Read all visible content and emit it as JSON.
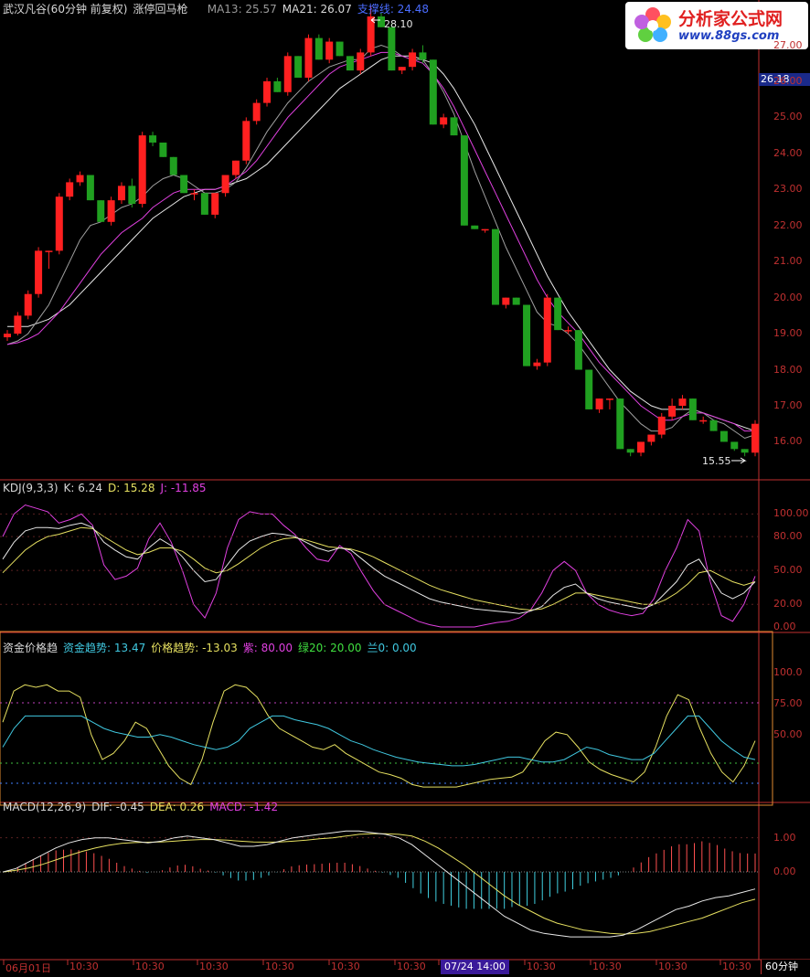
{
  "header": {
    "stock_title": "武汉凡谷(60分钟 前复权)",
    "indicator_name": "涨停回马枪",
    "ma13": "MA13: 25.57",
    "ma21": "MA21: 26.07",
    "support": "支撑线: 24.48"
  },
  "logo": {
    "title": "分析家公式网",
    "url": "www.88gs.com"
  },
  "price_panel": {
    "current_price": "26.18",
    "high_label": "28.10",
    "low_label": "15.55",
    "axis_labels": [
      "27.00",
      "26.00",
      "25.00",
      "24.00",
      "23.00",
      "22.00",
      "21.00",
      "20.00",
      "19.00",
      "18.00",
      "17.00",
      "16.00"
    ],
    "ylim": [
      15.2,
      27.9
    ]
  },
  "kdj_panel": {
    "title": "KDJ(9,3,3)",
    "k": "K: 6.24",
    "d": "D: 15.28",
    "j": "J: -11.85",
    "axis_labels": [
      "100.00",
      "80.00",
      "50.00",
      "20.00",
      "0.00"
    ]
  },
  "fund_panel": {
    "title": "资金价格趋",
    "fund": "资金趋势: 13.47",
    "price": "价格趋势: -13.03",
    "purple": "紫: 80.00",
    "green": "绿20: 20.00",
    "blue": "兰0: 0.00",
    "axis_labels": [
      "100.0",
      "75.00",
      "50.00"
    ]
  },
  "macd_panel": {
    "title": "MACD(12,26,9)",
    "dif": "DIF: -0.45",
    "dea": "DEA: 0.26",
    "macd": "MACD: -1.42",
    "axis_labels": [
      "1.00",
      "0.00"
    ]
  },
  "x_axis": {
    "labels": [
      "06月01日",
      "10:30",
      "10:30",
      "10:30",
      "10:30",
      "10:30",
      "10:30",
      "07/24 14:00",
      "10:30",
      "10:30",
      "10:30",
      "10:30"
    ],
    "period": "60分钟"
  },
  "colors": {
    "up": "#ff2020",
    "down": "#20a020",
    "grid": "#c03030",
    "ma5": "#ffffff",
    "ma13": "#e040e0",
    "ma21": "#ffffff"
  },
  "chart_data": {
    "type": "candlestick",
    "candles": [
      [
        18.9,
        19.1,
        18.8,
        19.0
      ],
      [
        19.0,
        19.6,
        18.95,
        19.5
      ],
      [
        19.5,
        20.2,
        19.4,
        20.1
      ],
      [
        20.1,
        21.4,
        20.0,
        21.3
      ],
      [
        21.3,
        21.3,
        20.8,
        21.3
      ],
      [
        21.3,
        22.9,
        21.2,
        22.8
      ],
      [
        22.8,
        23.3,
        22.7,
        23.2
      ],
      [
        23.2,
        23.5,
        23.1,
        23.4
      ],
      [
        23.4,
        23.4,
        22.7,
        22.7
      ],
      [
        22.7,
        22.7,
        22.1,
        22.1
      ],
      [
        22.1,
        22.8,
        22.0,
        22.7
      ],
      [
        22.7,
        23.2,
        22.6,
        23.1
      ],
      [
        23.1,
        23.3,
        22.5,
        22.6
      ],
      [
        22.6,
        24.6,
        22.5,
        24.5
      ],
      [
        24.5,
        24.6,
        24.2,
        24.3
      ],
      [
        24.3,
        24.3,
        23.9,
        23.9
      ],
      [
        23.9,
        23.9,
        23.4,
        23.4
      ],
      [
        23.4,
        23.4,
        22.9,
        22.9
      ],
      [
        22.9,
        23.0,
        22.7,
        22.9
      ],
      [
        22.9,
        22.9,
        22.3,
        22.3
      ],
      [
        22.3,
        22.9,
        22.2,
        22.9
      ],
      [
        22.9,
        23.4,
        22.8,
        23.4
      ],
      [
        23.4,
        23.8,
        23.3,
        23.8
      ],
      [
        23.8,
        25.0,
        23.7,
        24.9
      ],
      [
        24.9,
        25.5,
        24.8,
        25.4
      ],
      [
        25.4,
        26.1,
        25.3,
        26.0
      ],
      [
        26.0,
        26.1,
        25.7,
        25.7
      ],
      [
        25.7,
        26.8,
        25.6,
        26.7
      ],
      [
        26.7,
        26.7,
        26.1,
        26.1
      ],
      [
        26.1,
        27.3,
        26.0,
        27.2
      ],
      [
        27.2,
        27.3,
        26.6,
        26.6
      ],
      [
        26.6,
        27.2,
        26.5,
        27.1
      ],
      [
        27.1,
        27.1,
        26.7,
        26.7
      ],
      [
        26.7,
        26.7,
        26.3,
        26.3
      ],
      [
        26.3,
        26.9,
        26.2,
        26.8
      ],
      [
        26.8,
        28.1,
        26.7,
        27.8
      ],
      [
        27.8,
        27.9,
        27.5,
        27.5
      ],
      [
        27.5,
        27.6,
        26.3,
        26.3
      ],
      [
        26.3,
        26.4,
        26.2,
        26.4
      ],
      [
        26.4,
        26.9,
        26.3,
        26.8
      ],
      [
        26.8,
        27.0,
        26.5,
        26.6
      ],
      [
        26.6,
        26.6,
        24.8,
        24.8
      ],
      [
        24.8,
        25.1,
        24.7,
        25.0
      ],
      [
        25.0,
        25.0,
        24.5,
        24.5
      ],
      [
        24.5,
        24.5,
        22.0,
        22.0
      ],
      [
        22.0,
        22.0,
        21.9,
        21.9
      ],
      [
        21.9,
        21.9,
        21.8,
        21.9
      ],
      [
        21.9,
        21.9,
        19.8,
        19.8
      ],
      [
        19.8,
        20.0,
        19.7,
        20.0
      ],
      [
        20.0,
        20.0,
        19.8,
        19.8
      ],
      [
        19.8,
        19.8,
        18.1,
        18.1
      ],
      [
        18.1,
        18.3,
        18.0,
        18.2
      ],
      [
        18.2,
        20.1,
        18.1,
        20.0
      ],
      [
        20.0,
        20.0,
        19.1,
        19.1
      ],
      [
        19.1,
        19.2,
        19.0,
        19.1
      ],
      [
        19.1,
        19.1,
        18.0,
        18.0
      ],
      [
        18.0,
        18.0,
        16.9,
        16.9
      ],
      [
        16.9,
        17.2,
        16.8,
        17.2
      ],
      [
        17.2,
        17.2,
        16.9,
        17.2
      ],
      [
        17.2,
        17.2,
        15.8,
        15.8
      ],
      [
        15.8,
        15.8,
        15.6,
        15.7
      ],
      [
        15.7,
        16.0,
        15.6,
        16.0
      ],
      [
        16.0,
        16.2,
        15.9,
        16.2
      ],
      [
        16.2,
        16.8,
        16.1,
        16.7
      ],
      [
        16.7,
        17.2,
        16.6,
        17.0
      ],
      [
        17.0,
        17.3,
        16.9,
        17.2
      ],
      [
        17.2,
        17.2,
        16.6,
        16.6
      ],
      [
        16.6,
        16.7,
        16.5,
        16.6
      ],
      [
        16.6,
        16.6,
        16.3,
        16.3
      ],
      [
        16.3,
        16.3,
        16.0,
        16.0
      ],
      [
        16.0,
        16.0,
        15.75,
        15.8
      ],
      [
        15.8,
        15.8,
        15.6,
        15.7
      ],
      [
        15.7,
        16.6,
        15.6,
        16.5
      ]
    ],
    "ma_fast": [
      18.7,
      18.8,
      19.0,
      19.4,
      19.8,
      20.4,
      21.0,
      21.6,
      22.0,
      22.1,
      22.3,
      22.5,
      22.6,
      22.8,
      23.1,
      23.3,
      23.4,
      23.3,
      23.1,
      22.9,
      22.9,
      23.0,
      23.2,
      23.6,
      24.1,
      24.6,
      25.0,
      25.4,
      25.7,
      26.0,
      26.2,
      26.4,
      26.5,
      26.6,
      26.6,
      26.9,
      27.0,
      26.9,
      26.7,
      26.6,
      26.6,
      26.2,
      25.7,
      25.1,
      24.3,
      23.5,
      22.8,
      22.1,
      21.4,
      20.8,
      20.2,
      19.6,
      19.3,
      19.2,
      19.0,
      18.7,
      18.3,
      17.9,
      17.5,
      17.1,
      16.8,
      16.5,
      16.3,
      16.3,
      16.4,
      16.7,
      16.9,
      16.8,
      16.6,
      16.5,
      16.3,
      16.1,
      16.2
    ],
    "ma13": [
      18.7,
      18.75,
      18.85,
      19.0,
      19.3,
      19.6,
      20.0,
      20.4,
      20.8,
      21.2,
      21.5,
      21.8,
      22.0,
      22.2,
      22.5,
      22.7,
      22.9,
      23.0,
      23.0,
      23.0,
      23.0,
      23.1,
      23.3,
      23.5,
      23.8,
      24.2,
      24.6,
      25.0,
      25.3,
      25.6,
      25.9,
      26.2,
      26.4,
      26.5,
      26.6,
      26.7,
      26.8,
      26.8,
      26.7,
      26.6,
      26.5,
      26.2,
      25.8,
      25.3,
      24.7,
      24.1,
      23.5,
      22.9,
      22.3,
      21.7,
      21.1,
      20.5,
      20.0,
      19.6,
      19.3,
      19.0,
      18.6,
      18.2,
      17.9,
      17.6,
      17.3,
      17.0,
      16.8,
      16.6,
      16.6,
      16.7,
      16.8,
      16.8,
      16.7,
      16.6,
      16.5,
      16.3,
      16.3
    ],
    "ma21": [
      19.2,
      19.2,
      19.2,
      19.3,
      19.4,
      19.6,
      19.8,
      20.1,
      20.4,
      20.7,
      21.0,
      21.3,
      21.6,
      21.9,
      22.2,
      22.4,
      22.6,
      22.8,
      22.9,
      23.0,
      23.0,
      23.1,
      23.2,
      23.3,
      23.5,
      23.7,
      24.0,
      24.3,
      24.6,
      24.9,
      25.2,
      25.5,
      25.8,
      26.0,
      26.2,
      26.4,
      26.6,
      26.7,
      26.7,
      26.7,
      26.6,
      26.5,
      26.2,
      25.8,
      25.3,
      24.8,
      24.2,
      23.6,
      23.0,
      22.4,
      21.8,
      21.2,
      20.6,
      20.1,
      19.6,
      19.2,
      18.8,
      18.4,
      18.0,
      17.7,
      17.4,
      17.2,
      17.0,
      16.9,
      16.9,
      16.9,
      16.9,
      16.8,
      16.7,
      16.6,
      16.5,
      16.4,
      16.3
    ],
    "kdj_k": [
      60,
      75,
      85,
      88,
      88,
      87,
      90,
      92,
      88,
      75,
      68,
      62,
      60,
      70,
      78,
      72,
      62,
      50,
      40,
      42,
      55,
      68,
      76,
      80,
      83,
      82,
      80,
      75,
      70,
      67,
      70,
      68,
      60,
      52,
      45,
      40,
      35,
      30,
      25,
      22,
      20,
      18,
      16,
      15,
      14,
      13,
      12,
      14,
      18,
      28,
      35,
      38,
      30,
      25,
      22,
      20,
      18,
      16,
      20,
      30,
      40,
      55,
      60,
      45,
      30,
      25,
      30,
      40
    ],
    "kdj_d": [
      48,
      58,
      68,
      75,
      80,
      82,
      85,
      88,
      87,
      80,
      74,
      68,
      64,
      66,
      70,
      70,
      67,
      60,
      52,
      48,
      50,
      56,
      63,
      70,
      75,
      78,
      79,
      77,
      74,
      71,
      70,
      69,
      66,
      62,
      57,
      52,
      47,
      42,
      37,
      33,
      30,
      27,
      24,
      22,
      20,
      18,
      16,
      15,
      16,
      20,
      25,
      30,
      30,
      28,
      26,
      24,
      22,
      20,
      20,
      24,
      30,
      38,
      48,
      50,
      45,
      40,
      37,
      40
    ],
    "kdj_j": [
      80,
      100,
      108,
      105,
      102,
      92,
      95,
      100,
      90,
      55,
      42,
      45,
      52,
      78,
      92,
      75,
      50,
      20,
      8,
      30,
      70,
      95,
      102,
      100,
      100,
      90,
      82,
      70,
      60,
      58,
      72,
      65,
      48,
      32,
      20,
      15,
      10,
      5,
      2,
      0,
      0,
      0,
      0,
      2,
      4,
      5,
      8,
      15,
      30,
      50,
      58,
      50,
      30,
      20,
      15,
      12,
      10,
      12,
      25,
      50,
      70,
      95,
      85,
      40,
      10,
      5,
      20,
      45
    ],
    "fund_trend": [
      40,
      55,
      65,
      65,
      65,
      65,
      65,
      65,
      60,
      55,
      52,
      50,
      48,
      48,
      50,
      48,
      45,
      42,
      40,
      38,
      40,
      45,
      55,
      60,
      65,
      65,
      62,
      60,
      58,
      55,
      50,
      45,
      42,
      38,
      35,
      32,
      30,
      28,
      27,
      26,
      25,
      25,
      26,
      28,
      30,
      32,
      32,
      30,
      28,
      28,
      30,
      35,
      40,
      38,
      34,
      32,
      30,
      30,
      35,
      45,
      55,
      65,
      65,
      55,
      45,
      38,
      32,
      30
    ],
    "price_trend": [
      60,
      85,
      90,
      88,
      90,
      85,
      85,
      80,
      50,
      30,
      35,
      45,
      60,
      55,
      40,
      25,
      15,
      10,
      30,
      60,
      85,
      90,
      88,
      80,
      65,
      55,
      50,
      45,
      40,
      38,
      42,
      35,
      30,
      25,
      20,
      18,
      15,
      10,
      8,
      8,
      8,
      8,
      10,
      12,
      14,
      15,
      16,
      20,
      32,
      45,
      52,
      50,
      40,
      28,
      22,
      18,
      15,
      12,
      20,
      40,
      65,
      82,
      78,
      55,
      35,
      20,
      12,
      25,
      45
    ],
    "macd_dif": [
      0.0,
      0.1,
      0.3,
      0.5,
      0.7,
      0.85,
      0.95,
      1.0,
      1.0,
      0.95,
      0.9,
      0.85,
      0.9,
      1.0,
      1.05,
      1.0,
      0.95,
      0.85,
      0.75,
      0.75,
      0.8,
      0.9,
      1.0,
      1.05,
      1.1,
      1.15,
      1.2,
      1.2,
      1.15,
      1.1,
      1.0,
      0.8,
      0.5,
      0.2,
      -0.1,
      -0.4,
      -0.7,
      -1.0,
      -1.3,
      -1.5,
      -1.7,
      -1.8,
      -1.85,
      -1.9,
      -1.9,
      -1.9,
      -1.9,
      -1.85,
      -1.7,
      -1.5,
      -1.3,
      -1.1,
      -1.0,
      -0.85,
      -0.75,
      -0.7,
      -0.6,
      -0.5
    ],
    "macd_dea": [
      0.0,
      0.05,
      0.12,
      0.22,
      0.35,
      0.48,
      0.6,
      0.7,
      0.78,
      0.84,
      0.86,
      0.87,
      0.88,
      0.9,
      0.93,
      0.95,
      0.95,
      0.93,
      0.9,
      0.88,
      0.87,
      0.88,
      0.9,
      0.93,
      0.97,
      1.0,
      1.05,
      1.1,
      1.12,
      1.12,
      1.1,
      1.05,
      0.9,
      0.7,
      0.45,
      0.2,
      -0.1,
      -0.4,
      -0.7,
      -0.95,
      -1.15,
      -1.35,
      -1.5,
      -1.6,
      -1.7,
      -1.75,
      -1.8,
      -1.82,
      -1.8,
      -1.75,
      -1.65,
      -1.55,
      -1.45,
      -1.35,
      -1.2,
      -1.05,
      -0.9,
      -0.8
    ],
    "macd_hist_note": "histogram = 2*(DIF-DEA)"
  }
}
